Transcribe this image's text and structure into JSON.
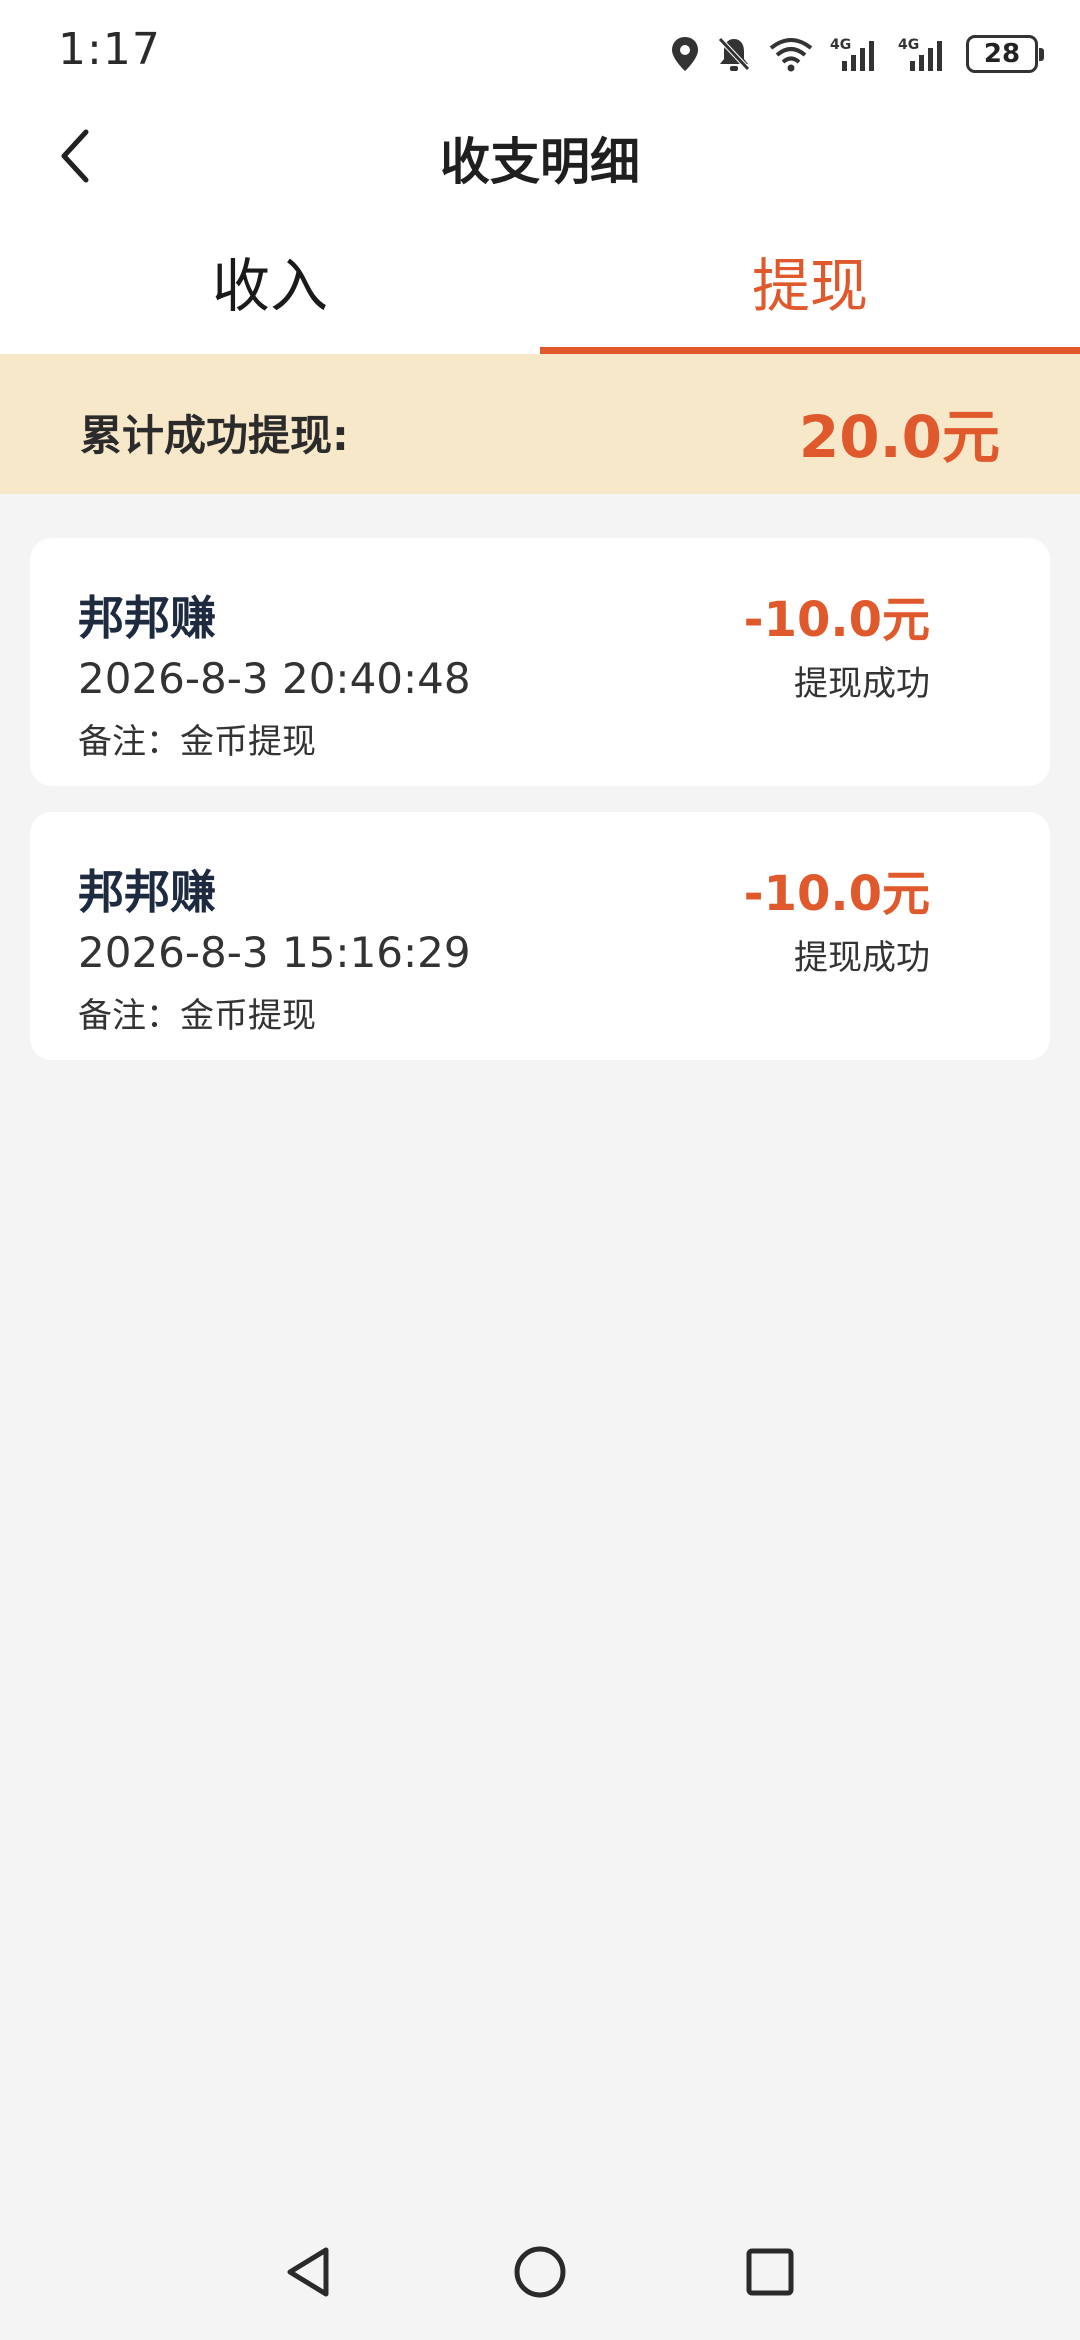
{
  "status_bar": {
    "time": "1:17",
    "battery": "28",
    "icons": [
      "location-icon",
      "bell-muted-icon",
      "wifi-icon",
      "signal-4g-icon",
      "signal-4g-icon",
      "battery-icon"
    ]
  },
  "header": {
    "title": "收支明细",
    "back_icon": "chevron-left-icon"
  },
  "tabs": [
    {
      "label": "收入",
      "active": false
    },
    {
      "label": "提现",
      "active": true
    }
  ],
  "summary": {
    "label": "累计成功提现:",
    "amount": "20.0元"
  },
  "records": [
    {
      "name": "邦邦赚",
      "time": "2026-8-3 20:40:48",
      "note": "备注：金币提现",
      "amount": "-10.0元",
      "status": "提现成功"
    },
    {
      "name": "邦邦赚",
      "time": "2026-8-3 15:16:29",
      "note": "备注：金币提现",
      "amount": "-10.0元",
      "status": "提现成功"
    }
  ],
  "colors": {
    "accent": "#e0592c",
    "summary_bg": "#f8e8ca",
    "page_bg": "#f4f4f4"
  },
  "nav_bar": [
    "back-triangle-icon",
    "home-circle-icon",
    "recents-square-icon"
  ]
}
